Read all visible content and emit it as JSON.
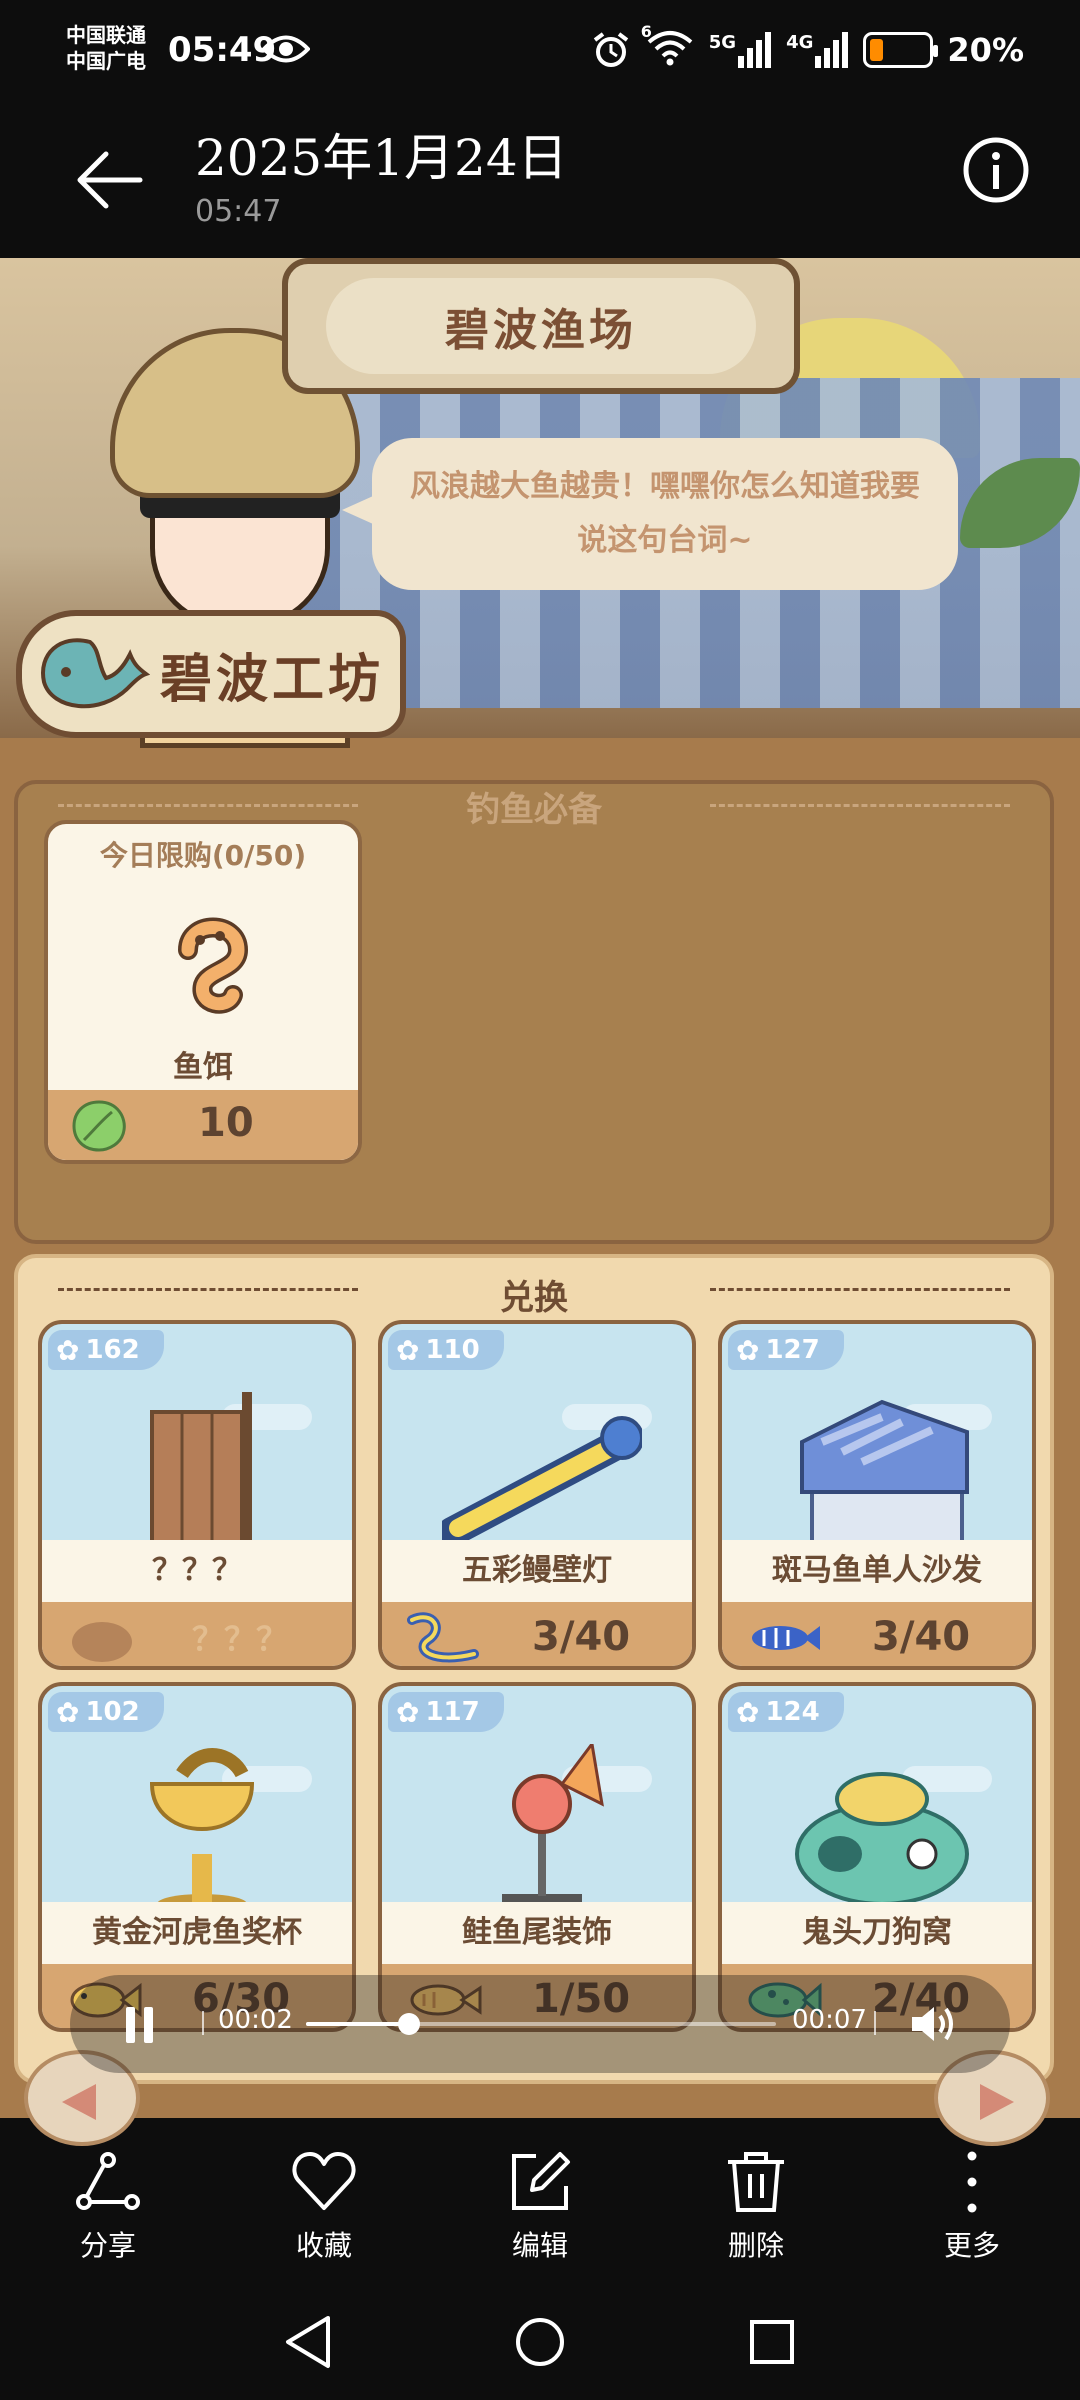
{
  "status_bar": {
    "carrier_1": "中国联通",
    "carrier_2": "中国广电",
    "time": "05:49",
    "wifi_badge": "6",
    "net_1": "5G",
    "net_2": "4G",
    "battery_percent": "20%",
    "battery_level": 0.2,
    "battery_color": "#ff8c00"
  },
  "header": {
    "date": "2025年1月24日",
    "time": "05:47"
  },
  "game": {
    "banner_title": "碧波渔场",
    "speech": "风浪越大鱼越贵！嘿嘿你怎么知道我要说这句台词~",
    "workshop_name": "碧波工坊",
    "essentials": {
      "title": "钓鱼必备",
      "item": {
        "limit": "今日限购(0/50)",
        "name": "鱼饵",
        "price": "10"
      }
    },
    "exchange": {
      "title": "兑换",
      "items": [
        {
          "points": "162",
          "name": "？？？",
          "cost": "？？？",
          "icon": "unknown-silhouette-icon"
        },
        {
          "points": "110",
          "name": "五彩鳗壁灯",
          "cost": "3/40",
          "icon": "eel-icon"
        },
        {
          "points": "127",
          "name": "斑马鱼单人沙发",
          "cost": "3/40",
          "icon": "zebrafish-icon"
        },
        {
          "points": "102",
          "name": "黄金河虎鱼奖杯",
          "cost": "6/30",
          "icon": "yellow-fish-icon"
        },
        {
          "points": "117",
          "name": "鲑鱼尾装饰",
          "cost": "1/50",
          "icon": "salmon-icon"
        },
        {
          "points": "124",
          "name": "鬼头刀狗窝",
          "cost": "2/40",
          "icon": "mahi-fish-icon"
        }
      ]
    }
  },
  "video": {
    "current": "00:02",
    "total": "00:07",
    "progress": 0.22
  },
  "toolbar": {
    "share": "分享",
    "favorite": "收藏",
    "edit": "编辑",
    "delete": "删除",
    "more": "更多"
  }
}
